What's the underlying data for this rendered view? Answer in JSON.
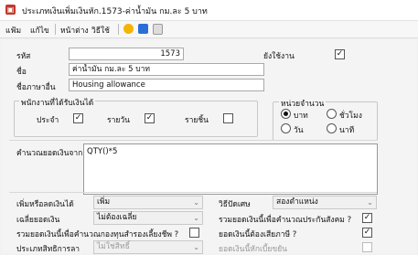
{
  "window": {
    "title": "ประเภทเงินเพิ่มเงินหัก.1573-ค่าน้ำมัน กม.ละ 5 บาท"
  },
  "menu": {
    "file": "แฟ้ม",
    "edit": "แก้ไข",
    "page": "หน้าต่าง",
    "help": "วิธีใช้"
  },
  "form": {
    "code_label": "รหัส",
    "code_value": "1573",
    "in_use_label": "ยังใช้งาน",
    "in_use_checked": "✓",
    "name_label": "ชื่อ",
    "name_value": "ค่าน้ำมัน กม.ละ 5 บาท",
    "name_en_label": "ชื่อภาษาอื่น",
    "name_en_value": "Housing allowance"
  },
  "employee_group": {
    "title": "พนักงานที่ได้รับเงินได้",
    "monthly_label": "ประจำ",
    "monthly_checked": "✓",
    "daily_label": "รายวัน",
    "daily_checked": "✓",
    "piece_label": "รายชิ้น",
    "piece_checked": ""
  },
  "unit_group": {
    "title": "หน่วยจำนวน",
    "baht": "บาท",
    "hour": "ชั่วโมง",
    "day": "วัน",
    "minute": "นาที",
    "selected": "baht"
  },
  "calc": {
    "label": "คำนวณยอดเงินจาก",
    "formula": "QTY()*5"
  },
  "settings": {
    "add_deduct_label": "เพิ่มหรือลดเงินได้",
    "add_deduct_value": "เพิ่ม",
    "rounding_label": "วิธีปัดเศษ",
    "rounding_value": "สองตำแหน่ง",
    "average_label": "เฉลี่ยยอดเงิน",
    "average_value": "ไม่ต้องเฉลี่ย",
    "social_security_label": "รวมยอดเงินนี้เพื่อคำนวณประกันสังคม ?",
    "social_security_checked": "✓",
    "provident_label": "รวมยอดเงินนี้เพื่อคำนวณกองทุนสำรองเลี้ยงชีพ ?",
    "provident_checked": "",
    "taxable_label": "ยอดเงินนี้ต้องเสียภาษี ?",
    "taxable_checked": "✓",
    "insurance_label": "ประเภทสิทธิการลา",
    "insurance_value": "ไม่ใช่สิทธิ์",
    "other_label": "ยอดเงินนี้หักเบี้ยขยัน",
    "other_checked": ""
  },
  "colors": {
    "accent": "#c0392b",
    "icon_yellow": "#f5b400",
    "icon_blue": "#2a6fd6"
  }
}
